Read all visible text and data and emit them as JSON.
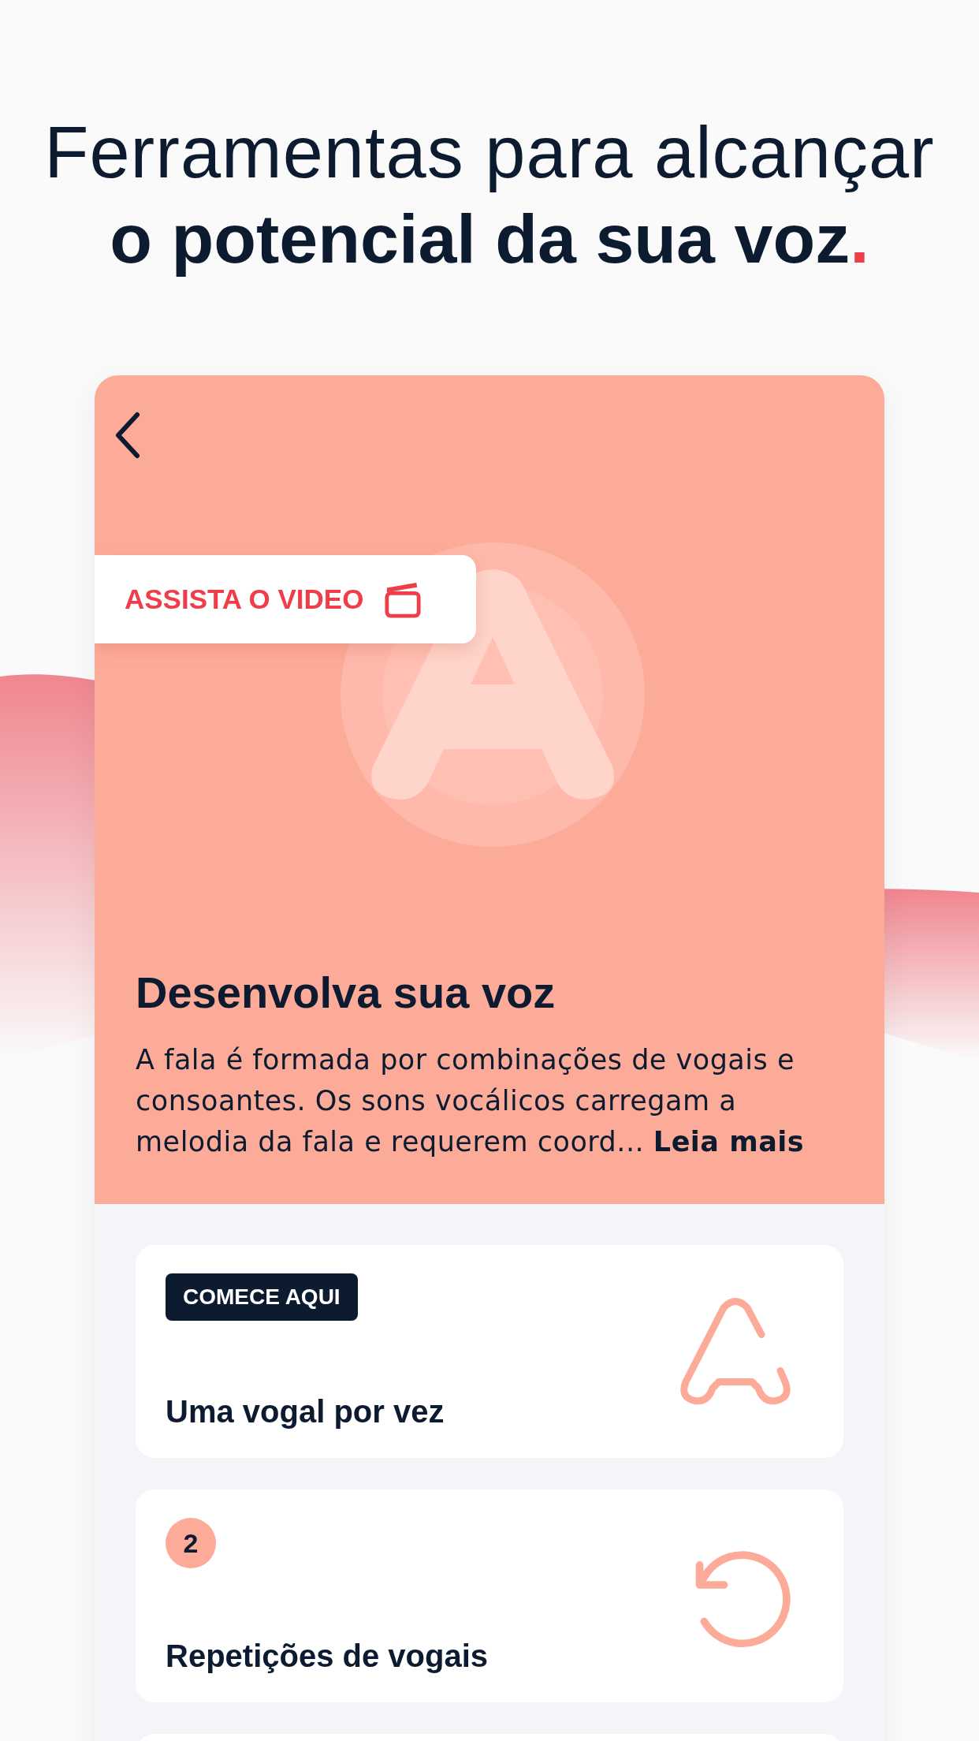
{
  "headline": {
    "line1": "Ferramentas para alcançar",
    "line2": "o potencial da sua voz",
    "accent": "."
  },
  "screen": {
    "video_button": "ASSISTA O VIDEO",
    "title": "Desenvolva sua voz",
    "description": "A fala é formada por combinações de vogais e consoantes. Os sons vocálicos carregam a melodia da fala e requerem coord...",
    "read_more": "Leia mais"
  },
  "lessons": [
    {
      "kind": "start",
      "badge": "COMECE AQUI",
      "title": "Uma vogal por vez"
    },
    {
      "kind": "step",
      "badge": "2",
      "title": "Repetições de vogais"
    }
  ]
}
